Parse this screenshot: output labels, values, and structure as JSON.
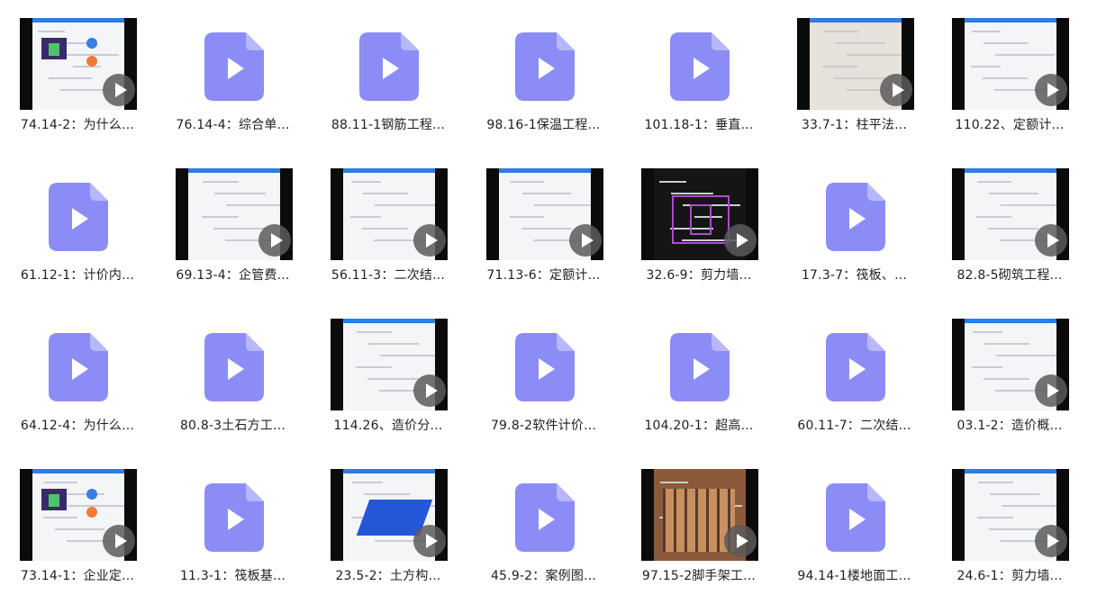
{
  "colors": {
    "file_icon_fill": "#8c8cf7",
    "file_icon_play": "#ffffff",
    "screen_accent": "#2b7de9"
  },
  "items": [
    {
      "label": "74.14-2：为什么...",
      "thumb": "video",
      "icon": "video-thumbnail"
    },
    {
      "label": "76.14-4：综合单...",
      "thumb": "file",
      "icon": "video-file-icon"
    },
    {
      "label": "88.11-1钢筋工程...",
      "thumb": "file",
      "icon": "video-file-icon"
    },
    {
      "label": "98.16-1保温工程...",
      "thumb": "file",
      "icon": "video-file-icon"
    },
    {
      "label": "101.18-1：垂直...",
      "thumb": "file",
      "icon": "video-file-icon"
    },
    {
      "label": "33.7-1：柱平法...",
      "thumb": "video",
      "icon": "video-thumbnail"
    },
    {
      "label": "110.22、定额计...",
      "thumb": "video",
      "icon": "video-thumbnail"
    },
    {
      "label": "61.12-1：计价内...",
      "thumb": "file",
      "icon": "video-file-icon"
    },
    {
      "label": "69.13-4：企管费...",
      "thumb": "video",
      "icon": "video-thumbnail"
    },
    {
      "label": "56.11-3：二次结...",
      "thumb": "video",
      "icon": "video-thumbnail"
    },
    {
      "label": "71.13-6：定额计...",
      "thumb": "video",
      "icon": "video-thumbnail"
    },
    {
      "label": "32.6-9：剪力墙...",
      "thumb": "video",
      "icon": "video-thumbnail"
    },
    {
      "label": "17.3-7：筏板、...",
      "thumb": "file",
      "icon": "video-file-icon"
    },
    {
      "label": "82.8-5砌筑工程...",
      "thumb": "video",
      "icon": "video-thumbnail"
    },
    {
      "label": "64.12-4：为什么...",
      "thumb": "file",
      "icon": "video-file-icon"
    },
    {
      "label": "80.8-3土石方工...",
      "thumb": "file",
      "icon": "video-file-icon"
    },
    {
      "label": "114.26、造价分...",
      "thumb": "video",
      "icon": "video-thumbnail"
    },
    {
      "label": "79.8-2软件计价...",
      "thumb": "file",
      "icon": "video-file-icon"
    },
    {
      "label": "104.20-1：超高...",
      "thumb": "file",
      "icon": "video-file-icon"
    },
    {
      "label": "60.11-7：二次结...",
      "thumb": "file",
      "icon": "video-file-icon"
    },
    {
      "label": "03.1-2：造价概...",
      "thumb": "video",
      "icon": "video-thumbnail"
    },
    {
      "label": "73.14-1：企业定...",
      "thumb": "video",
      "icon": "video-thumbnail"
    },
    {
      "label": "11.3-1：筏板基...",
      "thumb": "file",
      "icon": "video-file-icon"
    },
    {
      "label": "23.5-2：土方构...",
      "thumb": "video",
      "icon": "video-thumbnail"
    },
    {
      "label": "45.9-2：案例图...",
      "thumb": "file",
      "icon": "video-file-icon"
    },
    {
      "label": "97.15-2脚手架工...",
      "thumb": "video",
      "icon": "video-thumbnail"
    },
    {
      "label": "94.14-1楼地面工...",
      "thumb": "file",
      "icon": "video-file-icon"
    },
    {
      "label": "24.6-1：剪力墙...",
      "thumb": "video",
      "icon": "video-thumbnail"
    }
  ]
}
